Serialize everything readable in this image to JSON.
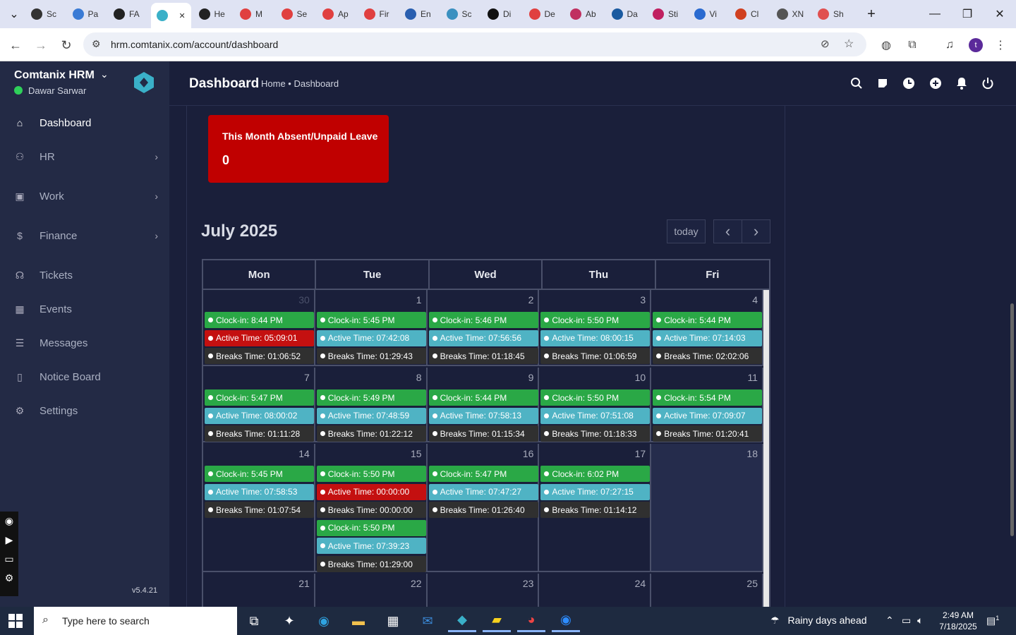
{
  "browser": {
    "tabs": [
      {
        "label": "Sc",
        "icon": "screenshot-icon"
      },
      {
        "label": "Pa",
        "icon": "wifi-icon"
      },
      {
        "label": "FA",
        "icon": "fa-icon"
      },
      {
        "label": "",
        "icon": "comtanix-icon",
        "active": true
      },
      {
        "label": "He",
        "icon": "v-icon"
      },
      {
        "label": "M",
        "icon": "red-diamond-icon"
      },
      {
        "label": "Se",
        "icon": "red-diamond-icon"
      },
      {
        "label": "Ap",
        "icon": "red-diamond-icon"
      },
      {
        "label": "Fir",
        "icon": "red-diamond-icon"
      },
      {
        "label": "En",
        "icon": "check-icon"
      },
      {
        "label": "Sc",
        "icon": "blue-circle-icon"
      },
      {
        "label": "Di",
        "icon": "x-icon"
      },
      {
        "label": "De",
        "icon": "red-diamond-icon"
      },
      {
        "label": "Ab",
        "icon": "red-diamond-icon"
      },
      {
        "label": "Da",
        "icon": "scale-icon"
      },
      {
        "label": "Sti",
        "icon": "pen-icon"
      },
      {
        "label": "Vi",
        "icon": "wave-icon"
      },
      {
        "label": "Cl",
        "icon": "claude-icon"
      },
      {
        "label": "XN",
        "icon": "globe-icon"
      },
      {
        "label": "Sh",
        "icon": "ring-icon"
      }
    ],
    "url": "hrm.comtanix.com/account/dashboard",
    "profile_initial": "t"
  },
  "sidebar": {
    "brand": "Comtanix HRM",
    "user": "Dawar Sarwar",
    "items": [
      {
        "label": "Dashboard",
        "icon": "home-icon",
        "active": true,
        "chevron": false
      },
      {
        "label": "HR",
        "icon": "users-icon",
        "chevron": true
      },
      {
        "label": "Work",
        "icon": "briefcase-icon",
        "chevron": true
      },
      {
        "label": "Finance",
        "icon": "dollar-icon",
        "chevron": true
      },
      {
        "label": "Tickets",
        "icon": "headset-icon",
        "chevron": false
      },
      {
        "label": "Events",
        "icon": "calendar-icon",
        "chevron": false
      },
      {
        "label": "Messages",
        "icon": "message-icon",
        "chevron": false
      },
      {
        "label": "Notice Board",
        "icon": "clipboard-icon",
        "chevron": false
      },
      {
        "label": "Settings",
        "icon": "gear-icon",
        "chevron": false
      }
    ],
    "version": "v5.4.21"
  },
  "header": {
    "title": "Dashboard",
    "breadcrumb": "Home • Dashboard"
  },
  "absent_card": {
    "title": "This Month Absent/Unpaid Leave",
    "value": "0"
  },
  "calendar": {
    "title": "July 2025",
    "today_label": "today",
    "prev_label": "‹",
    "next_label": "›",
    "weekdays": [
      "Mon",
      "Tue",
      "Wed",
      "Thu",
      "Fri"
    ],
    "weeks": [
      {
        "days": [
          {
            "num": "30",
            "other_month": true,
            "events": [
              {
                "text": "Clock-in: 8:44 PM",
                "type": "green"
              },
              {
                "text": "Active Time: 05:09:01",
                "type": "red"
              },
              {
                "text": "Breaks Time: 01:06:52",
                "type": "dark"
              }
            ]
          },
          {
            "num": "1",
            "events": [
              {
                "text": "Clock-in: 5:45 PM",
                "type": "green"
              },
              {
                "text": "Active Time: 07:42:08",
                "type": "teal"
              },
              {
                "text": "Breaks Time: 01:29:43",
                "type": "dark"
              }
            ]
          },
          {
            "num": "2",
            "events": [
              {
                "text": "Clock-in: 5:46 PM",
                "type": "green"
              },
              {
                "text": "Active Time: 07:56:56",
                "type": "teal"
              },
              {
                "text": "Breaks Time: 01:18:45",
                "type": "dark"
              }
            ]
          },
          {
            "num": "3",
            "events": [
              {
                "text": "Clock-in: 5:50 PM",
                "type": "green"
              },
              {
                "text": "Active Time: 08:00:15",
                "type": "teal"
              },
              {
                "text": "Breaks Time: 01:06:59",
                "type": "dark"
              }
            ]
          },
          {
            "num": "4",
            "events": [
              {
                "text": "Clock-in: 5:44 PM",
                "type": "green"
              },
              {
                "text": "Active Time: 07:14:03",
                "type": "teal"
              },
              {
                "text": "Breaks Time: 02:02:06",
                "type": "dark"
              }
            ]
          }
        ]
      },
      {
        "days": [
          {
            "num": "7",
            "events": [
              {
                "text": "Clock-in: 5:47 PM",
                "type": "green"
              },
              {
                "text": "Active Time: 08:00:02",
                "type": "teal"
              },
              {
                "text": "Breaks Time: 01:11:28",
                "type": "dark"
              }
            ]
          },
          {
            "num": "8",
            "events": [
              {
                "text": "Clock-in: 5:49 PM",
                "type": "green"
              },
              {
                "text": "Active Time: 07:48:59",
                "type": "teal"
              },
              {
                "text": "Breaks Time: 01:22:12",
                "type": "dark"
              }
            ]
          },
          {
            "num": "9",
            "events": [
              {
                "text": "Clock-in: 5:44 PM",
                "type": "green"
              },
              {
                "text": "Active Time: 07:58:13",
                "type": "teal"
              },
              {
                "text": "Breaks Time: 01:15:34",
                "type": "dark"
              }
            ]
          },
          {
            "num": "10",
            "events": [
              {
                "text": "Clock-in: 5:50 PM",
                "type": "green"
              },
              {
                "text": "Active Time: 07:51:08",
                "type": "teal"
              },
              {
                "text": "Breaks Time: 01:18:33",
                "type": "dark"
              }
            ]
          },
          {
            "num": "11",
            "events": [
              {
                "text": "Clock-in: 5:54 PM",
                "type": "green"
              },
              {
                "text": "Active Time: 07:09:07",
                "type": "teal"
              },
              {
                "text": "Breaks Time: 01:20:41",
                "type": "dark"
              }
            ]
          }
        ]
      },
      {
        "days": [
          {
            "num": "14",
            "events": [
              {
                "text": "Clock-in: 5:45 PM",
                "type": "green"
              },
              {
                "text": "Active Time: 07:58:53",
                "type": "teal"
              },
              {
                "text": "Breaks Time: 01:07:54",
                "type": "dark"
              }
            ]
          },
          {
            "num": "15",
            "events": [
              {
                "text": "Clock-in: 5:50 PM",
                "type": "green"
              },
              {
                "text": "Active Time: 00:00:00",
                "type": "red"
              },
              {
                "text": "Breaks Time: 00:00:00",
                "type": "dark"
              },
              {
                "text": "Clock-in: 5:50 PM",
                "type": "green"
              },
              {
                "text": "Active Time: 07:39:23",
                "type": "teal"
              },
              {
                "text": "Breaks Time: 01:29:00",
                "type": "dark"
              }
            ]
          },
          {
            "num": "16",
            "events": [
              {
                "text": "Clock-in: 5:47 PM",
                "type": "green"
              },
              {
                "text": "Active Time: 07:47:27",
                "type": "teal"
              },
              {
                "text": "Breaks Time: 01:26:40",
                "type": "dark"
              }
            ]
          },
          {
            "num": "17",
            "events": [
              {
                "text": "Clock-in: 6:02 PM",
                "type": "green"
              },
              {
                "text": "Active Time: 07:27:15",
                "type": "teal"
              },
              {
                "text": "Breaks Time: 01:14:12",
                "type": "dark"
              }
            ]
          },
          {
            "num": "18",
            "today": true,
            "events": []
          }
        ]
      },
      {
        "days": [
          {
            "num": "21",
            "events": []
          },
          {
            "num": "22",
            "events": []
          },
          {
            "num": "23",
            "events": []
          },
          {
            "num": "24",
            "events": []
          },
          {
            "num": "25",
            "events": []
          }
        ]
      }
    ]
  },
  "taskbar": {
    "search_placeholder": "Type here to search",
    "weather": "Rainy days ahead",
    "time": "2:49 AM",
    "date": "7/18/2025",
    "notification_count": "1"
  },
  "colors": {
    "green": "#2aa846",
    "teal": "#4fb3c4",
    "red": "#c41010",
    "dark": "#303030",
    "absent_card": "#c00000"
  }
}
